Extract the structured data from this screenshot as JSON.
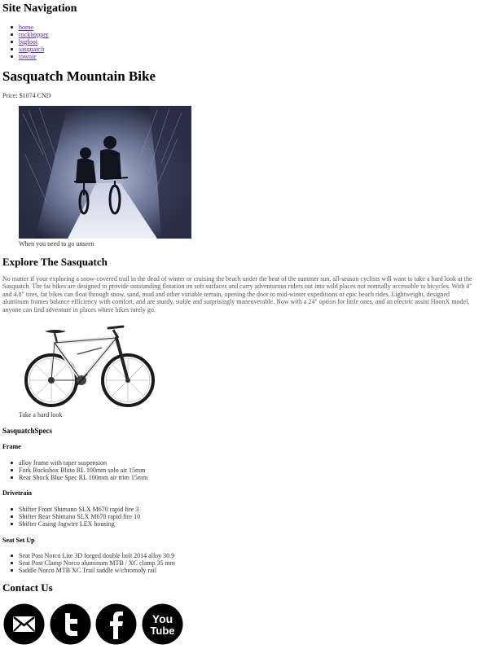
{
  "nav": {
    "title": "Site Navigation",
    "links": [
      "home",
      "rockhopper",
      "bigfoot",
      "sasquatch",
      "townie"
    ]
  },
  "product": {
    "title": "Sasquatch Mountain Bike",
    "price": "Price: $1074 CND"
  },
  "hero": {
    "caption": "When you need to go unseen"
  },
  "explore": {
    "title": "Explore The Sasquatch",
    "text": "No matter if your exploring a snow-covered trail in the dead of winter or cruising the beach under the heat of the summer sun, all-season cyclists will want to take a hard look at the Sasquatch. The fat bikes are designed to provide outstanding flotation on soft surfaces and carry adventurous riders out into wild places not normally accessible to bicycles. With 4\" and 4.8\" tires, fat bikes can float through snow, sand, mud and other variable terrain, opening the door to mid-winter expeditions or epic beach rides. Lightweight, designed aluminum frames balance efficiency with comfort, and are sturdy, stable and surprisingly maneuverable. Now with a 24\" option for little ones, and an electric assist HoonX model, anyone can find adventure in places where bikes rarely go."
  },
  "bike": {
    "caption": "Take a hard look"
  },
  "specs": {
    "title": "SasquatchSpecs",
    "frame": {
      "heading": "Frame",
      "items": [
        "alloy frame with taper suspension",
        "Fork Rockshox Bluto RL 100mm solo air 15mm",
        "Rear Shock Blue Spec RL 100mm air trim 15mm"
      ]
    },
    "drivetrain": {
      "heading": "Drivetrain",
      "items": [
        "Shifter Front Shimano SLX M670 rapid fire 3",
        "Shifter Rear Shimano SLX M670 rapid fire 10",
        "Shifter Casing Jagwire LEX housing"
      ]
    },
    "seat": {
      "heading": "Seat Set Up",
      "items": [
        "Seat Post Norco Lite 3D forged double bolt 2014 alloy 30.9",
        "Seat Post Clamp Norco aluminum MTB / XC clamp 35 mm",
        "Saddle Norco MTB XC Trail saddle w/chromoly rail"
      ]
    }
  },
  "contact": {
    "title": "Contact Us",
    "icons": [
      "email-icon",
      "twitter-icon",
      "facebook-icon",
      "youtube-icon"
    ],
    "youtube_top": "You",
    "youtube_bottom": "Tube"
  }
}
